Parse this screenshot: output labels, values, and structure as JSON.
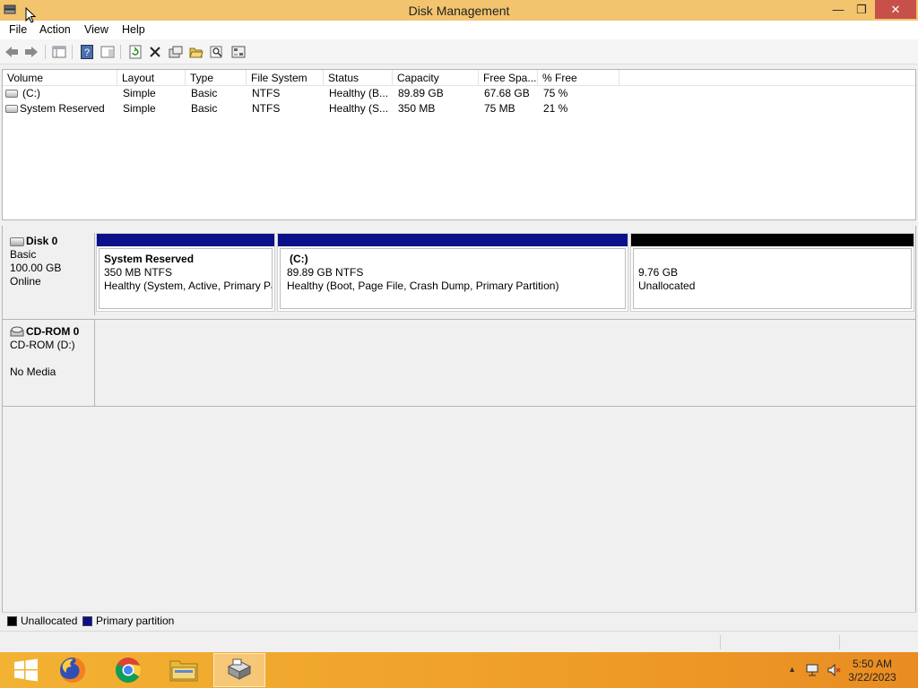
{
  "window": {
    "title": "Disk Management"
  },
  "menu": [
    "File",
    "Action",
    "View",
    "Help"
  ],
  "volume_list": {
    "columns": [
      "Volume",
      "Layout",
      "Type",
      "File System",
      "Status",
      "Capacity",
      "Free Spa...",
      "% Free"
    ],
    "rows": [
      [
        "(C:)",
        "Simple",
        "Basic",
        "NTFS",
        "Healthy (B...",
        "89.89 GB",
        "67.68 GB",
        "75 %"
      ],
      [
        "System Reserved",
        "Simple",
        "Basic",
        "NTFS",
        "Healthy (S...",
        "350 MB",
        "75 MB",
        "21 %"
      ]
    ]
  },
  "disks": [
    {
      "name": "Disk 0",
      "type": "Basic",
      "size": "100.00 GB",
      "state": "Online",
      "partitions": [
        {
          "title": "System Reserved",
          "size": "350 MB NTFS",
          "status": "Healthy (System, Active, Primary Pa",
          "kind": "primary"
        },
        {
          "title": "(C:)",
          "size": "89.89 GB NTFS",
          "status": "Healthy (Boot, Page File, Crash Dump, Primary Partition)",
          "kind": "primary"
        },
        {
          "title": "",
          "size": "9.76 GB",
          "status": "Unallocated",
          "kind": "unallocated"
        }
      ]
    },
    {
      "name": "CD-ROM 0",
      "type": "CD-ROM (D:)",
      "size": "",
      "state": "No Media"
    }
  ],
  "legend": [
    {
      "label": "Unallocated",
      "color": "#000000"
    },
    {
      "label": "Primary partition",
      "color": "#0c0f8a"
    }
  ],
  "colors": {
    "primary": "#0c0f8a",
    "unallocated": "#000000",
    "titlebar": "#f2c46e",
    "close": "#c7504a"
  },
  "taskbar": {
    "apps": [
      "start-icon",
      "firefox-icon",
      "chrome-icon",
      "file-explorer-icon",
      "disk-management-icon"
    ],
    "time": "5:50 AM",
    "date": "3/22/2023"
  }
}
